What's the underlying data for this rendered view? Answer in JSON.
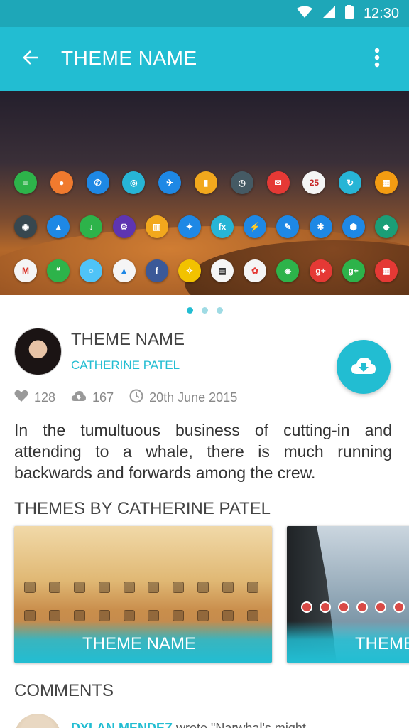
{
  "status_bar": {
    "time": "12:30",
    "icons": [
      "wifi-icon",
      "signal-icon",
      "battery-icon"
    ]
  },
  "app_bar": {
    "title": "THEME NAME",
    "back_icon": "arrow-back-icon",
    "menu_icon": "more-vert-icon"
  },
  "hero": {
    "pager": {
      "count": 3,
      "active": 0
    },
    "rows": [
      [
        {
          "c": "#2db34a",
          "g": "≡"
        },
        {
          "c": "#f07a2e",
          "g": "●"
        },
        {
          "c": "#1e88e5",
          "g": "✆"
        },
        {
          "c": "#27b5d6",
          "g": "◎"
        },
        {
          "c": "#1e88e5",
          "g": "✈"
        },
        {
          "c": "#f2a81d",
          "g": "▮"
        },
        {
          "c": "#455a64",
          "g": "◷"
        },
        {
          "c": "#e53935",
          "g": "✉"
        },
        {
          "c": "#f5f5f5",
          "g": "25",
          "t": "#c62828"
        },
        {
          "c": "#27b5d6",
          "g": "↻"
        },
        {
          "c": "#f39c12",
          "g": "▦"
        }
      ],
      [
        {
          "c": "#37474f",
          "g": "◉"
        },
        {
          "c": "#1e88e5",
          "g": "▲"
        },
        {
          "c": "#2db34a",
          "g": "↓"
        },
        {
          "c": "#5e35b1",
          "g": "⚙"
        },
        {
          "c": "#f2a81d",
          "g": "▥"
        },
        {
          "c": "#1e88e5",
          "g": "✦"
        },
        {
          "c": "#27b5d6",
          "g": "fx"
        },
        {
          "c": "#1e88e5",
          "g": "⚡"
        },
        {
          "c": "#1e88e5",
          "g": "✎"
        },
        {
          "c": "#1e88e5",
          "g": "✱"
        },
        {
          "c": "#1e88e5",
          "g": "⬢"
        },
        {
          "c": "#1b9e77",
          "g": "◆"
        }
      ],
      [
        {
          "c": "#f5f5f5",
          "g": "M",
          "t": "#d93025"
        },
        {
          "c": "#2db34a",
          "g": "❝"
        },
        {
          "c": "#4fc3f7",
          "g": "○"
        },
        {
          "c": "#f5f5f5",
          "g": "▲",
          "t": "#1e88e5"
        },
        {
          "c": "#3b5998",
          "g": "f"
        },
        {
          "c": "#f2c200",
          "g": "✧"
        },
        {
          "c": "#f5f5f5",
          "g": "▤",
          "t": "#333"
        },
        {
          "c": "#f5f5f5",
          "g": "✿",
          "t": "#e53935"
        },
        {
          "c": "#2db34a",
          "g": "◈"
        },
        {
          "c": "#e53935",
          "g": "g+"
        },
        {
          "c": "#2db34a",
          "g": "g+"
        },
        {
          "c": "#e53935",
          "g": "▦"
        }
      ]
    ]
  },
  "theme": {
    "title": "THEME NAME",
    "author": "CATHERINE PATEL",
    "likes": "128",
    "downloads": "167",
    "date": "20th June 2015",
    "description": "In the tumultuous business of cutting-in and attending to a whale, there is much running backwards and forwards among the crew."
  },
  "more_themes": {
    "heading": "THEMES BY CATHERINE PATEL",
    "cards": [
      {
        "caption": "THEME NAME"
      },
      {
        "caption": "THEME NAME"
      }
    ]
  },
  "comments": {
    "heading": "COMMENTS",
    "first": {
      "author": "DYLAN MENDEZ",
      "text": "wrote \"Narwhal's might..."
    }
  },
  "colors": {
    "accent": "#22bdd2",
    "status_bar": "#1ea7b8"
  }
}
